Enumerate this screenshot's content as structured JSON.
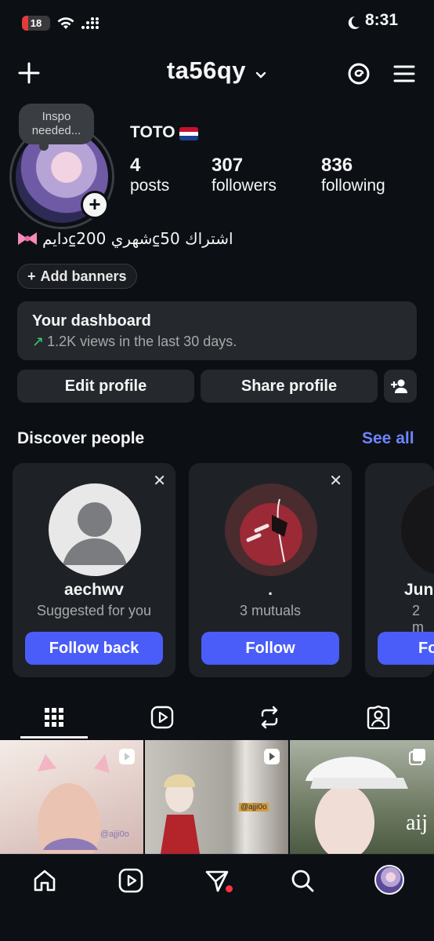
{
  "status_bar": {
    "battery": "18",
    "time": "8:31"
  },
  "header": {
    "username": "ta56qy"
  },
  "profile": {
    "note": "Inspo needed...",
    "display_name": "TOTO",
    "stats": [
      {
        "value": "4",
        "label": "posts"
      },
      {
        "value": "307",
        "label": "followers"
      },
      {
        "value": "836",
        "label": "following"
      }
    ],
    "bio": "اشتراك 50⃀شهري 200⃀دايم",
    "add_banners": "Add banners"
  },
  "dashboard": {
    "title": "Your dashboard",
    "subtitle": "1.2K views in the last 30 days."
  },
  "actions": {
    "edit": "Edit profile",
    "share": "Share profile"
  },
  "discover": {
    "title": "Discover people",
    "see_all": "See all",
    "cards": [
      {
        "name": "aechwv",
        "sub": "Suggested for you",
        "button": "Follow back"
      },
      {
        "name": ".",
        "sub": "3 mutuals",
        "button": "Follow"
      },
      {
        "name": "Jun",
        "sub": "2 m",
        "button": "Fo"
      }
    ]
  },
  "posts": [
    {
      "watermark": "@ajji0o"
    },
    {
      "watermark": "@ajji0o"
    },
    {
      "watermark": "aij"
    }
  ],
  "colors": {
    "background": "#0c1014",
    "accent": "#4a5df9",
    "link": "#6e84ff",
    "card": "#25292e"
  }
}
